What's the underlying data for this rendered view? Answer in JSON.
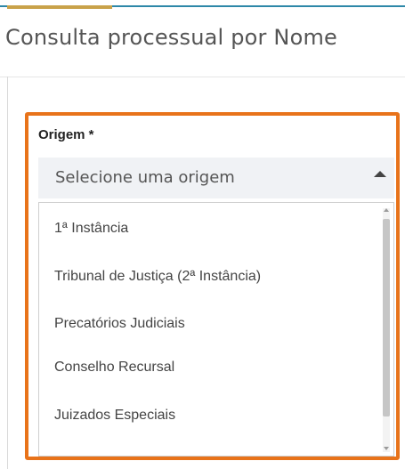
{
  "page": {
    "title": "Consulta processual por Nome"
  },
  "form": {
    "origem_label": "Origem *",
    "origem_placeholder": "Selecione uma origem"
  },
  "dropdown": {
    "options": [
      "1ª Instância",
      "Tribunal de Justiça (2ª Instância)",
      "Precatórios Judiciais",
      "Conselho Recursal",
      "Juizados Especiais"
    ]
  },
  "icons": {
    "select_arrow": "caret-up-icon",
    "scroll_up": "scroll-up-arrow-icon",
    "scroll_down": "scroll-down-arrow-icon"
  },
  "colors": {
    "highlight": "#e8731a",
    "top_accent": "#2e88a8",
    "top_gold": "#c9a24a",
    "select_bg": "#f0f2f5"
  }
}
